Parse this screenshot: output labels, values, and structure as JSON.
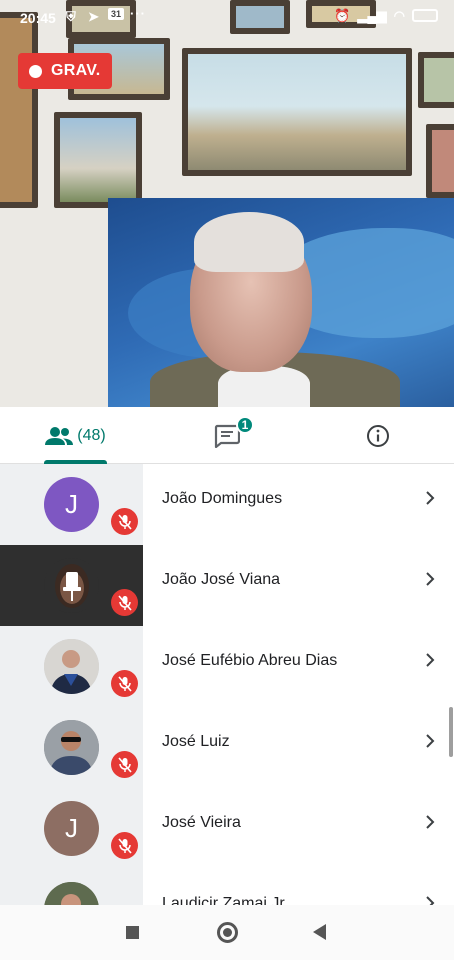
{
  "status_bar": {
    "time": "20:45",
    "left_icons": [
      "shield-icon",
      "telegram-icon",
      "calendar-icon"
    ],
    "calendar_day": "31",
    "more": "···",
    "right_icons": [
      "alarm-icon",
      "signal-icon",
      "wifi-icon",
      "battery-icon"
    ]
  },
  "recording": {
    "label": "GRAV."
  },
  "tabs": {
    "people_count": "(48)",
    "chat_unread": "1"
  },
  "participants": [
    {
      "name": "João Domingues",
      "initial": "J",
      "avatar_color": "#7e57c2",
      "muted": true
    },
    {
      "name": "João José Viana",
      "initial": "",
      "avatar_color": "#2f2f2f",
      "muted": true,
      "pinned_view": true
    },
    {
      "name": "José Eufébio Abreu Dias",
      "initial": "",
      "avatar_color": "#8a8f96",
      "muted": true
    },
    {
      "name": "José Luiz",
      "initial": "",
      "avatar_color": "#5d6670",
      "muted": true
    },
    {
      "name": "José Vieira",
      "initial": "J",
      "avatar_color": "#8d6e63",
      "muted": true
    },
    {
      "name": "Laudicir Zamai Jr",
      "initial": "",
      "avatar_color": "#6b7a5a",
      "muted": true
    }
  ],
  "colors": {
    "accent": "#00796b",
    "record": "#e53935",
    "mute": "#e53935"
  }
}
